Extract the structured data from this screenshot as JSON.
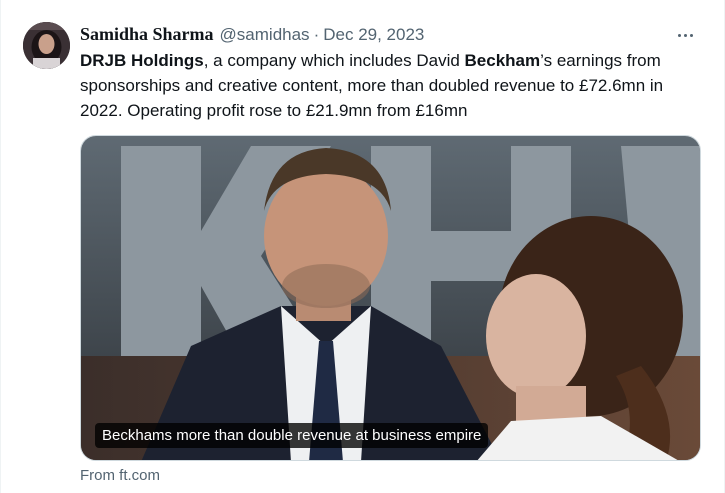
{
  "tweet": {
    "display_name": "Samidha Sharma",
    "handle": "@samidhas",
    "separator": "·",
    "date": "Dec 29, 2023",
    "text": {
      "bold1": "DRJB Holdings",
      "part1": ", a company which includes David ",
      "bold2": "Beckham",
      "part2": "’s earnings from sponsorships and creative content, more than doubled revenue to £72.6mn in 2022. Operating profit rose to £21.9mn from £16mn"
    }
  },
  "card": {
    "caption": "Beckhams more than double revenue at business empire",
    "source": "From ft.com"
  },
  "icons": {
    "more": "more-horizontal-icon"
  },
  "colors": {
    "text_primary": "#0f1419",
    "text_secondary": "#536471",
    "border": "#cfd9de"
  }
}
